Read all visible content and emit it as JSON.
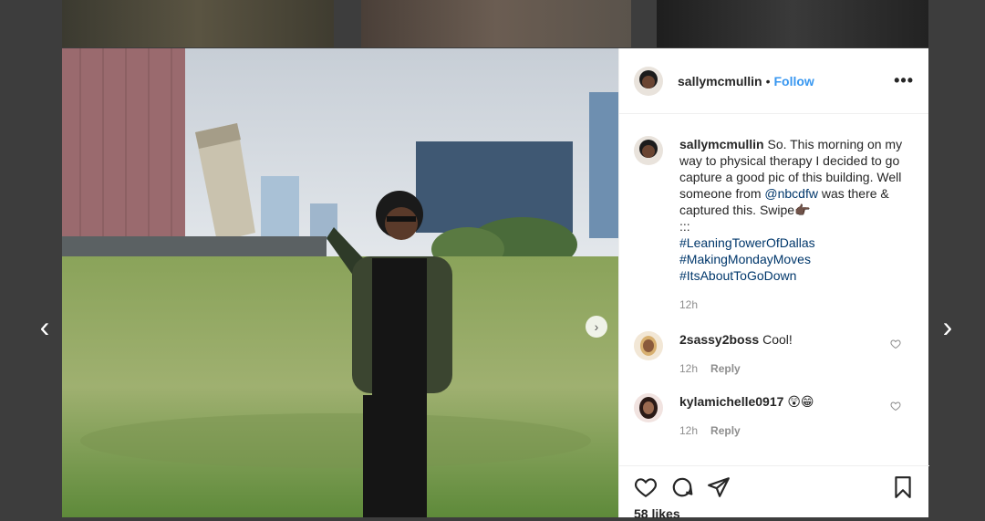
{
  "post": {
    "username": "sallymcmullin",
    "follow_label": "Follow",
    "more_label": "•••",
    "caption": {
      "username": "sallymcmullin",
      "text_1": "So. This morning on my way to physical therapy I decided to go capture a good pic of this building. Well someone from ",
      "mention": "@nbcdfw",
      "text_2": " was there & captured this. Swipe👉🏿",
      "separator": ":::",
      "hashtags": [
        "#LeaningTowerOfDallas",
        "#MakingMondayMoves",
        "#ItsAboutToGoDown"
      ],
      "time": "12h"
    },
    "comments": [
      {
        "username": "2sassy2boss",
        "text": "Cool!",
        "time": "12h",
        "reply_label": "Reply"
      },
      {
        "username": "kylamichelle0917",
        "text": "😲😁",
        "time": "12h",
        "reply_label": "Reply"
      }
    ],
    "likes": "58 likes"
  },
  "nav": {
    "prev": "‹",
    "next": "›",
    "photo_next": "›"
  },
  "icons": [
    "heart-icon",
    "comment-icon",
    "share-icon",
    "bookmark-icon",
    "chevron-left-icon",
    "chevron-right-icon"
  ],
  "colors": {
    "link": "#00376b",
    "follow": "#3897f0",
    "muted": "#8e8e8e",
    "backdrop": "#3d3d3d"
  }
}
